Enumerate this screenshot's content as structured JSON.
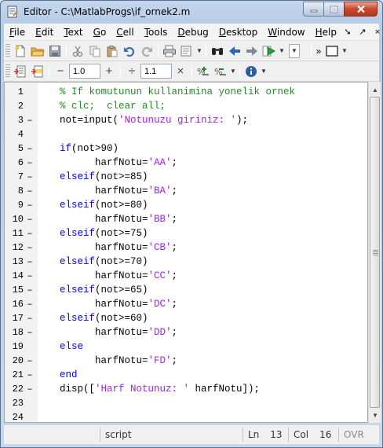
{
  "window": {
    "title": "Editor - C:\\MatlabProgs\\if_ornek2.m",
    "minimize_label": "",
    "maximize_label": "",
    "close_label": ""
  },
  "menu": {
    "items": [
      {
        "label": "File",
        "key": "F",
        "rest": "ile"
      },
      {
        "label": "Edit",
        "key": "E",
        "rest": "dit"
      },
      {
        "label": "Text",
        "key": "T",
        "rest": "ext"
      },
      {
        "label": "Go",
        "key": "G",
        "rest": "o"
      },
      {
        "label": "Cell",
        "key": "C",
        "rest": "ell"
      },
      {
        "label": "Tools",
        "key": "T",
        "rest": "ools",
        "prefix": ""
      },
      {
        "label": "Debug",
        "key": "D",
        "rest": "ebug"
      },
      {
        "label": "Desktop",
        "key": "D",
        "rest": "esktop"
      },
      {
        "label": "Window",
        "key": "W",
        "rest": "indow"
      },
      {
        "label": "Help",
        "key": "H",
        "rest": "elp"
      }
    ],
    "right_icons": [
      "dock-arrow-icon",
      "undock-arrow-icon",
      "close-x-icon"
    ]
  },
  "toolbar2": {
    "cell_minus_symbol": "−",
    "cell_value_1": "1.0",
    "cell_plus_symbol": "+",
    "cell_divide_symbol": "÷",
    "cell_value_2": "1.1",
    "cell_times_symbol": "×"
  },
  "editor": {
    "lines": [
      {
        "n": "1",
        "mark": "",
        "tokens": [
          {
            "t": "% If komutunun kullanimina yonelik ornek",
            "c": "comment"
          }
        ]
      },
      {
        "n": "2",
        "mark": "",
        "tokens": [
          {
            "t": "% clc;  clear all;",
            "c": "comment"
          }
        ]
      },
      {
        "n": "3",
        "mark": "–",
        "tokens": [
          {
            "t": "not=input(",
            "c": ""
          },
          {
            "t": "'Notunuzu giriniz: '",
            "c": "str"
          },
          {
            "t": ");",
            "c": ""
          }
        ]
      },
      {
        "n": "4",
        "mark": "",
        "tokens": []
      },
      {
        "n": "5",
        "mark": "–",
        "tokens": [
          {
            "t": "if",
            "c": "kw"
          },
          {
            "t": "(not>90)",
            "c": ""
          }
        ]
      },
      {
        "n": "6",
        "mark": "–",
        "tokens": [
          {
            "t": "      harfNotu=",
            "c": ""
          },
          {
            "t": "'AA'",
            "c": "str"
          },
          {
            "t": ";",
            "c": ""
          }
        ]
      },
      {
        "n": "7",
        "mark": "–",
        "tokens": [
          {
            "t": "elseif",
            "c": "kw"
          },
          {
            "t": "(not>=85)",
            "c": ""
          }
        ]
      },
      {
        "n": "8",
        "mark": "–",
        "tokens": [
          {
            "t": "      harfNotu=",
            "c": ""
          },
          {
            "t": "'BA'",
            "c": "str"
          },
          {
            "t": ";",
            "c": ""
          }
        ]
      },
      {
        "n": "9",
        "mark": "–",
        "tokens": [
          {
            "t": "elseif",
            "c": "kw"
          },
          {
            "t": "(not>=80)",
            "c": ""
          }
        ]
      },
      {
        "n": "10",
        "mark": "–",
        "tokens": [
          {
            "t": "      harfNotu=",
            "c": ""
          },
          {
            "t": "'BB'",
            "c": "str"
          },
          {
            "t": ";",
            "c": ""
          }
        ]
      },
      {
        "n": "11",
        "mark": "–",
        "tokens": [
          {
            "t": "elseif",
            "c": "kw"
          },
          {
            "t": "(not>=75)",
            "c": ""
          }
        ]
      },
      {
        "n": "12",
        "mark": "–",
        "tokens": [
          {
            "t": "      harfNotu=",
            "c": ""
          },
          {
            "t": "'CB'",
            "c": "str"
          },
          {
            "t": ";",
            "c": ""
          }
        ]
      },
      {
        "n": "13",
        "mark": "–",
        "tokens": [
          {
            "t": "elseif",
            "c": "kw"
          },
          {
            "t": "(not>=70)",
            "c": ""
          }
        ]
      },
      {
        "n": "14",
        "mark": "–",
        "tokens": [
          {
            "t": "      harfNotu=",
            "c": ""
          },
          {
            "t": "'CC'",
            "c": "str"
          },
          {
            "t": ";",
            "c": ""
          }
        ]
      },
      {
        "n": "15",
        "mark": "–",
        "tokens": [
          {
            "t": "elseif",
            "c": "kw"
          },
          {
            "t": "(not>=65)",
            "c": ""
          }
        ]
      },
      {
        "n": "16",
        "mark": "–",
        "tokens": [
          {
            "t": "      harfNotu=",
            "c": ""
          },
          {
            "t": "'DC'",
            "c": "str"
          },
          {
            "t": ";",
            "c": ""
          }
        ]
      },
      {
        "n": "17",
        "mark": "–",
        "tokens": [
          {
            "t": "elseif",
            "c": "kw"
          },
          {
            "t": "(not>=60)",
            "c": ""
          }
        ]
      },
      {
        "n": "18",
        "mark": "–",
        "tokens": [
          {
            "t": "      harfNotu=",
            "c": ""
          },
          {
            "t": "'DD'",
            "c": "str"
          },
          {
            "t": ";",
            "c": ""
          }
        ]
      },
      {
        "n": "19",
        "mark": "",
        "tokens": [
          {
            "t": "else",
            "c": "kw"
          }
        ]
      },
      {
        "n": "20",
        "mark": "–",
        "tokens": [
          {
            "t": "      harfNotu=",
            "c": ""
          },
          {
            "t": "'FD'",
            "c": "str"
          },
          {
            "t": ";",
            "c": ""
          }
        ]
      },
      {
        "n": "21",
        "mark": "–",
        "tokens": [
          {
            "t": "end",
            "c": "kw"
          }
        ]
      },
      {
        "n": "22",
        "mark": "–",
        "tokens": [
          {
            "t": "disp([",
            "c": ""
          },
          {
            "t": "'Harf Notunuz: '",
            "c": "str"
          },
          {
            "t": " harfNotu]);",
            "c": ""
          }
        ]
      },
      {
        "n": "23",
        "mark": "",
        "tokens": []
      },
      {
        "n": "24",
        "mark": "",
        "tokens": []
      }
    ],
    "colors": {
      "comment": "#228b22",
      "keyword": "#0000ff",
      "string": "#a020f0"
    }
  },
  "status": {
    "file_type": "script",
    "ln_label": "Ln",
    "ln_value": "13",
    "col_label": "Col",
    "col_value": "16",
    "mode": "OVR"
  }
}
